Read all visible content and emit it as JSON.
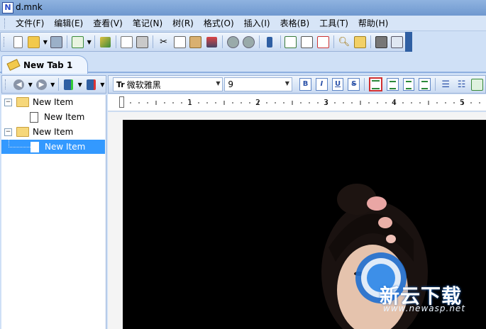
{
  "window": {
    "title": "d.mnk",
    "app_icon_letter": "N"
  },
  "menu": {
    "items": [
      "文件(F)",
      "编辑(E)",
      "查看(V)",
      "笔记(N)",
      "树(R)",
      "格式(O)",
      "插入(I)",
      "表格(B)",
      "工具(T)",
      "帮助(H)"
    ]
  },
  "toolbar": {
    "icons": [
      "new-icon",
      "open-icon",
      "dropdown-icon",
      "save-icon",
      "new-note-icon",
      "dropdown-icon",
      "highlight-icon",
      "print-preview-icon",
      "print-icon",
      "cut-icon",
      "copy-icon",
      "paste-icon",
      "spellcheck-icon",
      "undo-icon",
      "redo-icon",
      "tree-icon",
      "import-icon",
      "edit-icon",
      "delete-icon",
      "search-icon",
      "replace-icon",
      "book-icon",
      "dialog-icon"
    ]
  },
  "tabs": [
    {
      "label": "New Tab 1"
    }
  ],
  "tree": {
    "items": [
      {
        "label": "New Item",
        "type": "folder",
        "level": 0
      },
      {
        "label": "New Item",
        "type": "note",
        "level": 1
      },
      {
        "label": "New Item",
        "type": "folder",
        "level": 0
      },
      {
        "label": "New Item",
        "type": "note",
        "level": 1,
        "selected": true
      }
    ]
  },
  "format": {
    "font_name": "微软雅黑",
    "font_size": "9",
    "buttons": [
      "B",
      "I",
      "U",
      "S"
    ]
  },
  "ruler": {
    "marks": [
      "1",
      "2",
      "3",
      "4",
      "5"
    ]
  },
  "watermark": {
    "text": "新云下载",
    "url": "www.newasp.net"
  },
  "colors": {
    "selection": "#3399ff",
    "accent": "#2f5fa3",
    "chrome": "#cfe0f6"
  }
}
